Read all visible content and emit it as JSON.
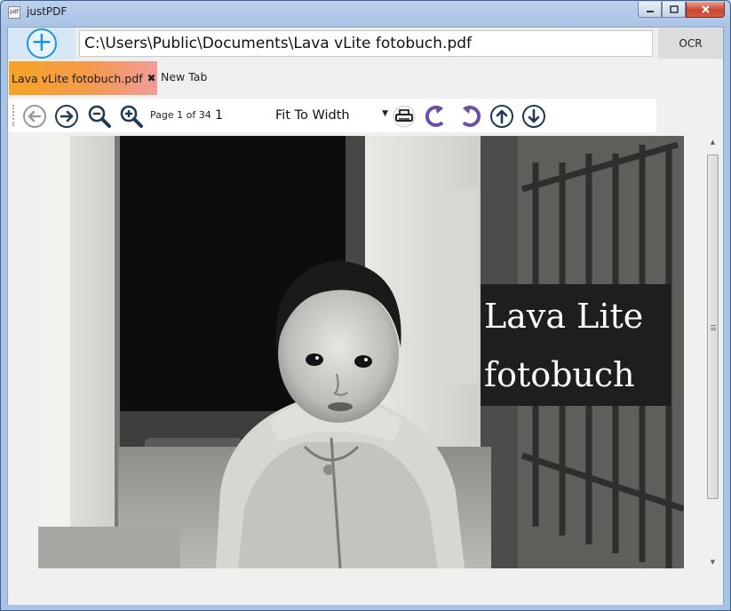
{
  "window": {
    "title": "justPDF",
    "app_icon_text": "pdf"
  },
  "address": {
    "path": "C:\\Users\\Public\\Documents\\Lava vLite fotobuch.pdf",
    "ocr_label": "OCR"
  },
  "tabs": [
    {
      "label": "Lava vLite fotobuch.pdf",
      "active": true,
      "close_glyph": "✖"
    },
    {
      "label": "New Tab",
      "active": false
    }
  ],
  "toolbar": {
    "page_label": "Page",
    "current_page": "1",
    "of_label": "of 34",
    "page_input": "1",
    "zoom_value": "Fit To Width",
    "icons": [
      "back-arrow-icon",
      "forward-arrow-icon",
      "zoom-out-icon",
      "zoom-in-icon",
      "print-icon",
      "rotate-left-icon",
      "rotate-right-icon",
      "page-up-icon",
      "page-down-icon"
    ]
  },
  "document": {
    "page_text_line1": "Lava Lite",
    "page_text_line2": "fotobuch"
  },
  "colors": {
    "accent_blue": "#1c95d8",
    "tab_active": "#f7a325",
    "rotate_purple": "#6a4fa8",
    "nav_dark": "#1f3a55"
  }
}
